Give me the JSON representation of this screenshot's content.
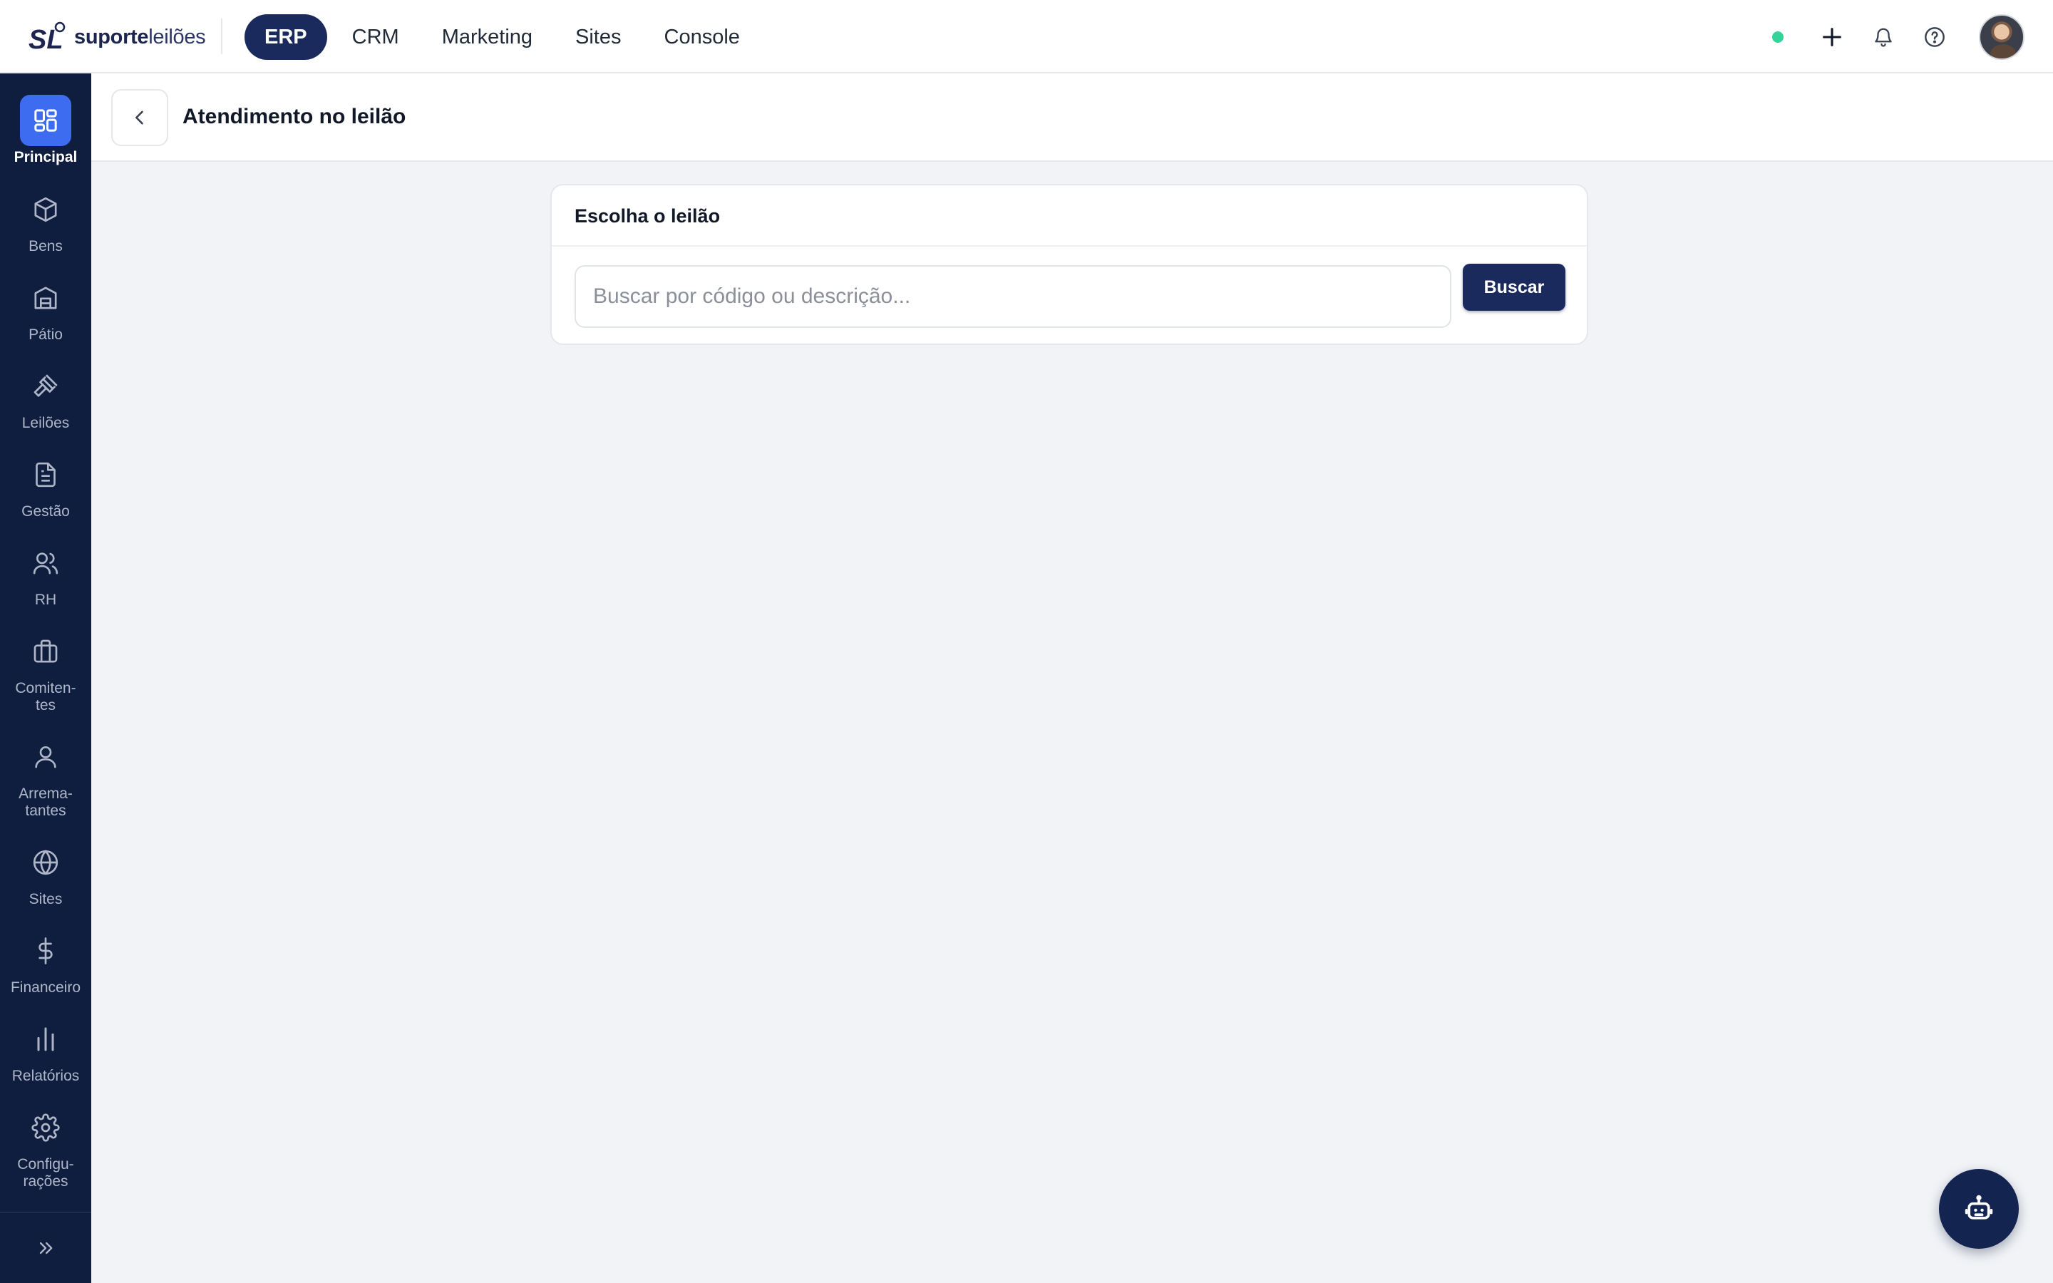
{
  "brand": {
    "name_bold": "suporte",
    "name_light": "leilões"
  },
  "top_nav": {
    "items": [
      {
        "label": "ERP",
        "active": true
      },
      {
        "label": "CRM",
        "active": false
      },
      {
        "label": "Marketing",
        "active": false
      },
      {
        "label": "Sites",
        "active": false
      },
      {
        "label": "Console",
        "active": false
      }
    ]
  },
  "top_right": {
    "status_color": "#34d399",
    "icons": [
      "plus-icon",
      "bell-icon",
      "help-icon"
    ]
  },
  "sidebar": {
    "items": [
      {
        "label": "Principal",
        "icon": "dashboard-icon",
        "active": true
      },
      {
        "label": "Bens",
        "icon": "box-icon"
      },
      {
        "label": "Pátio",
        "icon": "warehouse-icon"
      },
      {
        "label": "Leilões",
        "icon": "gavel-icon"
      },
      {
        "label": "Gestão",
        "icon": "document-icon"
      },
      {
        "label": "RH",
        "icon": "users-icon"
      },
      {
        "label": "Comiten-\ntes",
        "icon": "briefcase-icon"
      },
      {
        "label": "Arrema-\ntantes",
        "icon": "user-icon"
      },
      {
        "label": "Sites",
        "icon": "globe-icon"
      },
      {
        "label": "Financeiro",
        "icon": "dollar-icon"
      },
      {
        "label": "Relatórios",
        "icon": "bar-chart-icon"
      },
      {
        "label": "Configu-\nrações",
        "icon": "gear-icon"
      }
    ]
  },
  "page": {
    "title": "Atendimento no leilão"
  },
  "card": {
    "title": "Escolha o leilão",
    "search_placeholder": "Buscar por código ou descrição...",
    "search_value": "",
    "button_label": "Buscar"
  },
  "colors": {
    "brand_navy": "#1b2a5c",
    "sidebar_bg": "#0f1d3f",
    "active_blue": "#3d6cf0",
    "page_bg": "#f1f3f6"
  }
}
